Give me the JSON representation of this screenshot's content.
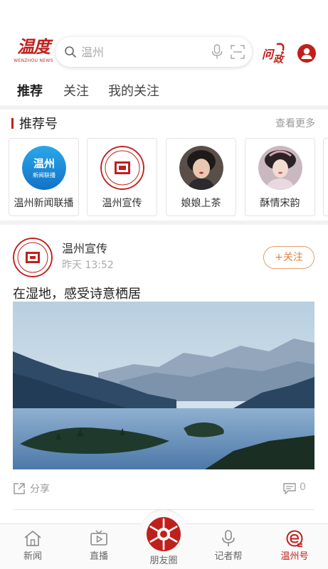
{
  "header": {
    "logo_text": "温度",
    "logo_subtext": "WENZHOU NEWS",
    "search_placeholder": "温州",
    "ask_label": "问政"
  },
  "tabs": [
    {
      "label": "推荐",
      "active": true
    },
    {
      "label": "关注",
      "active": false
    },
    {
      "label": "我的关注",
      "active": false
    }
  ],
  "recommend": {
    "title": "推荐号",
    "more_label": "查看更多",
    "accounts": [
      {
        "name": "温州新闻联播",
        "avatar_text": "温州",
        "avatar_subtext": "新闻联播"
      },
      {
        "name": "温州宣传"
      },
      {
        "name": "娘娘上茶"
      },
      {
        "name": "酥情宋韵"
      }
    ]
  },
  "post": {
    "author": "温州宣传",
    "time": "昨天  13:52",
    "follow_label": "+关注",
    "title": "在湿地，感受诗意栖居",
    "share_label": "分享",
    "comment_count": "0"
  },
  "bottom_nav": [
    {
      "label": "新闻",
      "icon": "home-icon",
      "active": false
    },
    {
      "label": "直播",
      "icon": "video-icon",
      "active": false
    },
    {
      "label": "朋友圈",
      "icon": "aperture-icon",
      "active": false
    },
    {
      "label": "记者帮",
      "icon": "mic-icon",
      "active": false
    },
    {
      "label": "温州号",
      "icon": "wenzhou-account-icon",
      "active": true
    }
  ],
  "colors": {
    "brand_red": "#c0201c",
    "follow_orange": "#e08040"
  }
}
